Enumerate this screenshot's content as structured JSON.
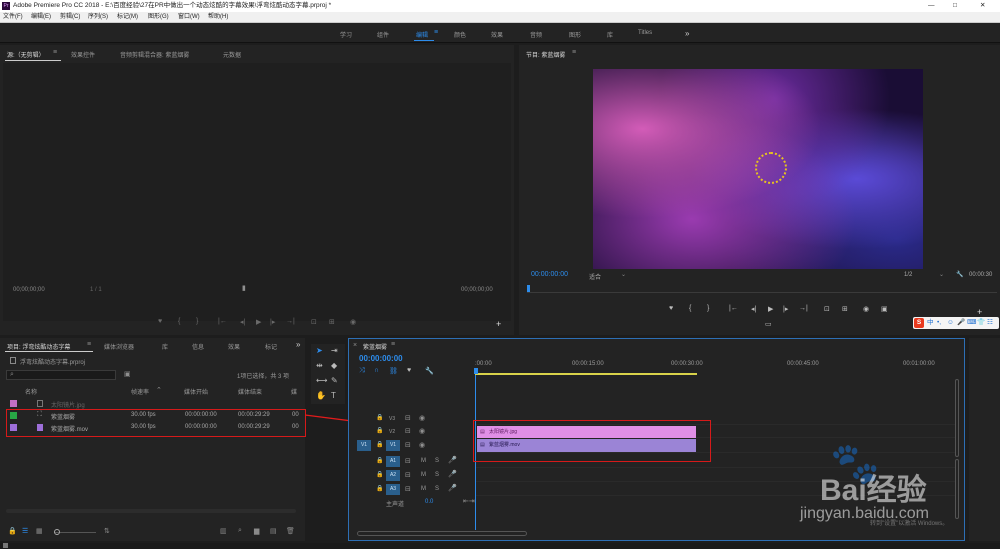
{
  "window": {
    "title": "Adobe Premiere Pro CC 2018 - E:\\百度经验\\27在PR中做出一个动态炫酷的字幕效果\\浮弯炫酷动态字幕.prproj *",
    "controls": [
      "—",
      "□",
      "✕"
    ]
  },
  "menu": [
    "文件(F)",
    "编辑(E)",
    "剪辑(C)",
    "序列(S)",
    "标记(M)",
    "图形(G)",
    "窗口(W)",
    "帮助(H)"
  ],
  "workspaces": {
    "items": [
      "学习",
      "组件",
      "编辑",
      "颜色",
      "效果",
      "音频",
      "图形",
      "库",
      "Titles"
    ],
    "active": "编辑",
    "more": "»"
  },
  "source": {
    "tabs": [
      "源:（无剪辑）",
      "效果控件",
      "音频剪辑混合器: 紫蓝烟雾",
      "元数据"
    ],
    "tc_left": "00;00;00;00",
    "tc_right": "00;00;00;00",
    "page": "1 / 1"
  },
  "program": {
    "tab": "节目: 紫蓝烟雾",
    "timecode": "00:00:00:00",
    "fit": "适合",
    "res": "1/2",
    "tc_right": "00:00:30"
  },
  "project": {
    "tabs": [
      "项目: 浮弯炫酷动态字幕",
      "媒体浏览器",
      "库",
      "信息",
      "效果",
      "标记"
    ],
    "file": "浮弯炫酷动态字幕.prproj",
    "count": "1项已选择，共 3 项",
    "columns": [
      "名称",
      "帧速率",
      "媒体开始",
      "媒体结束",
      "媒"
    ],
    "rows": [
      {
        "color": "#c26fc4",
        "name": "太阳镜片.jpg",
        "fps": "",
        "start": "",
        "end": "",
        "dim": true
      },
      {
        "color": "#28a745",
        "name": "紫蓝烟雾",
        "fps": "30.00 fps",
        "start": "00:00:00:00",
        "end": "00:00:29:29",
        "dim": false
      },
      {
        "color": "#9e6fd9",
        "name": "紫蓝烟雾.mov",
        "fps": "30.00 fps",
        "start": "00:00:00:00",
        "end": "00:00:29:29",
        "dim": false
      }
    ]
  },
  "timeline": {
    "tab": "紫蓝烟雾",
    "timecode": "00:00:00:00",
    "ruler": [
      ":00:00",
      "00:00:15:00",
      "00:00:30:00",
      "00:00:45:00",
      "00:01:00:00"
    ],
    "video_tracks": [
      "V3",
      "V2",
      "V1"
    ],
    "audio_tracks": [
      "A1",
      "A2",
      "A3"
    ],
    "master": "主声道",
    "master_val": "0.0",
    "clips": [
      {
        "name": "太阳镜片.jpg",
        "track": "V2"
      },
      {
        "name": "紫蓝烟雾.mov",
        "track": "V1"
      }
    ],
    "m": "M",
    "s": "S"
  },
  "watermark": {
    "brand": "Bai经验",
    "url": "jingyan.baidu.com",
    "win": "转到\"设置\"以激活 Windows。"
  },
  "ime": [
    "S",
    "中",
    "•,",
    "☺",
    "🎤",
    "⌨",
    "👕",
    "☷"
  ]
}
